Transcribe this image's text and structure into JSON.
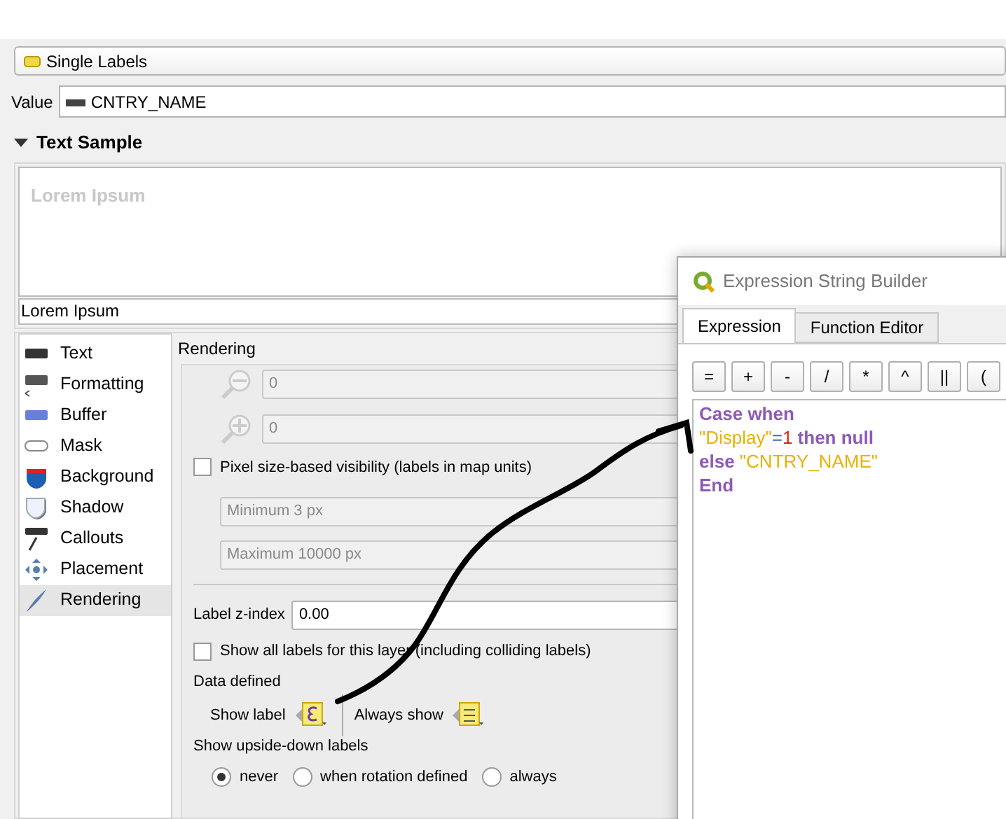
{
  "layer_type": {
    "label": "Single Labels"
  },
  "value": {
    "label": "Value",
    "field": "CNTRY_NAME"
  },
  "text_sample": {
    "title": "Text Sample",
    "expanded": true,
    "preview": "Lorem Ipsum",
    "sample_text": "Lorem Ipsum"
  },
  "sidebar": {
    "items": [
      {
        "label": "Text",
        "selected": false
      },
      {
        "label": "Formatting",
        "selected": false
      },
      {
        "label": "Buffer",
        "selected": false
      },
      {
        "label": "Mask",
        "selected": false
      },
      {
        "label": "Background",
        "selected": false
      },
      {
        "label": "Shadow",
        "selected": false
      },
      {
        "label": "Callouts",
        "selected": false
      },
      {
        "label": "Placement",
        "selected": false
      },
      {
        "label": "Rendering",
        "selected": true
      }
    ]
  },
  "rendering": {
    "title": "Rendering",
    "scale_fields": [
      {
        "value": "0",
        "disabled": true
      },
      {
        "value": "0",
        "disabled": true
      }
    ],
    "pixel_visibility": {
      "label": "Pixel size-based visibility (labels in map units)",
      "checked": false
    },
    "pixel_fields": [
      {
        "value": "Minimum 3 px",
        "disabled": true
      },
      {
        "value": "Maximum 10000 px",
        "disabled": true
      }
    ],
    "z_index": {
      "label": "Label z-index",
      "value": "0.00"
    },
    "show_all": {
      "label": "Show all labels for this layer (including colliding labels)",
      "checked": false
    },
    "data_defined": {
      "title": "Data defined",
      "show_label": "Show label",
      "always_show": "Always show"
    },
    "upside_down": {
      "title": "Show upside-down labels",
      "options": [
        {
          "label": "never",
          "selected": true
        },
        {
          "label": "when rotation defined",
          "selected": false
        },
        {
          "label": "always",
          "selected": false
        }
      ]
    }
  },
  "dialog": {
    "title": "Expression String Builder",
    "tabs": [
      {
        "label": "Expression",
        "selected": true
      },
      {
        "label": "Function Editor",
        "selected": false
      }
    ],
    "operators": [
      "=",
      "+",
      "-",
      "/",
      "*",
      "^",
      "||",
      "("
    ],
    "expression": [
      [
        {
          "kind": "keyword",
          "text": "Case when"
        }
      ],
      [
        {
          "kind": "string",
          "text": "\"Display\""
        },
        {
          "kind": "operator",
          "text": "="
        },
        {
          "kind": "number",
          "text": "1"
        },
        {
          "kind": "keyword",
          "text": " then null"
        }
      ],
      [
        {
          "kind": "keyword",
          "text": "else "
        },
        {
          "kind": "string",
          "text": "\"CNTRY_NAME\""
        }
      ],
      [
        {
          "kind": "keyword",
          "text": "End"
        }
      ]
    ]
  }
}
